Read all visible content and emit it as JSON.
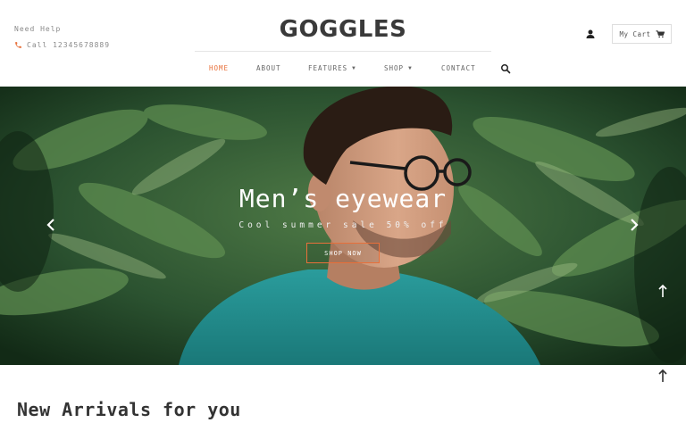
{
  "header": {
    "help_label": "Need Help",
    "phone_label": "Call 12345678889",
    "logo": "GOGGLES",
    "cart_label": "My Cart"
  },
  "nav": {
    "items": [
      {
        "label": "HOME",
        "active": true
      },
      {
        "label": "ABOUT",
        "active": false
      },
      {
        "label": "FEATURES",
        "active": false,
        "has_dropdown": true
      },
      {
        "label": "SHOP",
        "active": false,
        "has_dropdown": true
      },
      {
        "label": "CONTACT",
        "active": false
      }
    ]
  },
  "hero": {
    "title": "Men’s eyewear",
    "subtitle": "Cool summer sale 50% off",
    "button_label": "SHOP NOW"
  },
  "section": {
    "title": "New Arrivals for you"
  },
  "colors": {
    "accent": "#e8703a",
    "text_dark": "#333333",
    "text_muted": "#8a8a8a",
    "shirt": "#1e8a8a"
  },
  "icons": [
    "phone-icon",
    "user-icon",
    "cart-icon",
    "search-icon",
    "chevron-left-icon",
    "chevron-right-icon",
    "arrow-up-icon"
  ]
}
